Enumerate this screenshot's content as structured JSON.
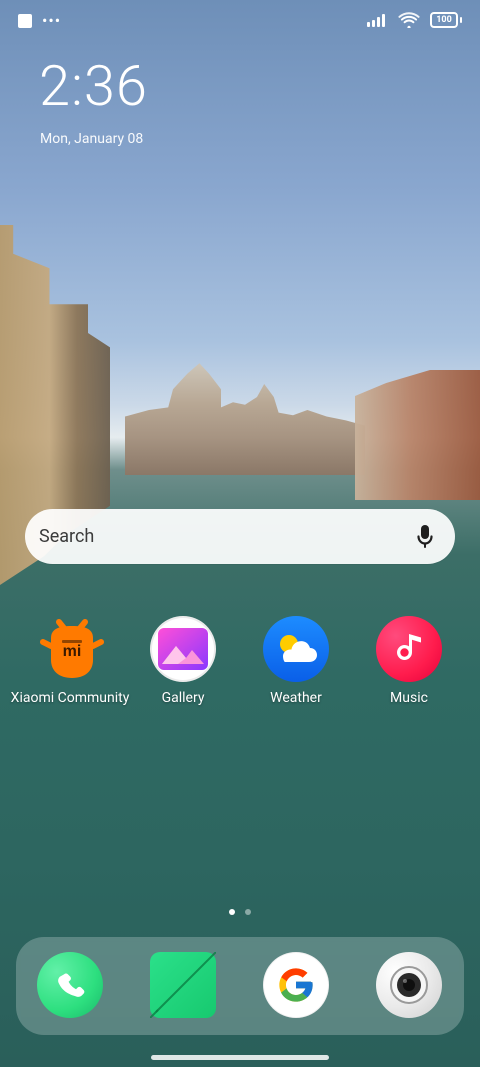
{
  "status_bar": {
    "left_icons": [
      "notification-square",
      "more-dots"
    ],
    "more_dots_text": "•••",
    "battery_text": "100"
  },
  "lockscreen": {
    "time": "2:36",
    "date": "Mon, January 08"
  },
  "search": {
    "placeholder": "Search"
  },
  "apps": [
    {
      "label": "Xiaomi Community",
      "icon": "xiaomi-community-icon",
      "color": "#ff7a00"
    },
    {
      "label": "Gallery",
      "icon": "gallery-icon",
      "color": "#e44ab7"
    },
    {
      "label": "Weather",
      "icon": "weather-icon",
      "color": "#1e88ff"
    },
    {
      "label": "Music",
      "icon": "music-icon",
      "color": "#ff2d55"
    }
  ],
  "page_indicator": {
    "pages": 2,
    "active_page": 1
  },
  "dock": [
    {
      "name": "phone",
      "icon": "phone-icon",
      "color": "#2ddf7f"
    },
    {
      "name": "messages",
      "icon": "messages-icon",
      "color": "#25d07a"
    },
    {
      "name": "google",
      "icon": "google-icon",
      "color": "#ffffff"
    },
    {
      "name": "camera",
      "icon": "camera-icon",
      "color": "#e9e9e9"
    }
  ]
}
